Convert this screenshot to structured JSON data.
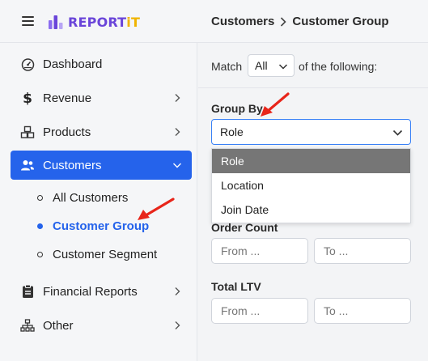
{
  "header": {
    "logo_part1": "REPORT",
    "logo_part2": "iT",
    "breadcrumb": [
      "Customers",
      "Customer Group"
    ]
  },
  "sidebar": {
    "items": [
      {
        "label": "Dashboard",
        "icon": "gauge-icon"
      },
      {
        "label": "Revenue",
        "icon": "dollar-icon"
      },
      {
        "label": "Products",
        "icon": "boxes-icon"
      },
      {
        "label": "Customers",
        "icon": "users-icon"
      },
      {
        "label": "Financial Reports",
        "icon": "clipboard-icon"
      },
      {
        "label": "Other",
        "icon": "sitemap-icon"
      }
    ],
    "sub_items": [
      {
        "label": "All Customers"
      },
      {
        "label": "Customer Group"
      },
      {
        "label": "Customer Segment"
      }
    ]
  },
  "main": {
    "match_prefix": "Match",
    "match_value": "All",
    "match_suffix": "of the following:",
    "group_by_label": "Group By",
    "group_by_value": "Role",
    "group_by_options": [
      "Role",
      "Location",
      "Join Date"
    ],
    "order_count_label": "Order Count",
    "total_ltv_label": "Total LTV",
    "from_placeholder": "From ...",
    "to_placeholder": "To ..."
  },
  "colors": {
    "accent": "#2563eb",
    "logo_purple": "#6a45d9",
    "logo_yellow": "#f0b400",
    "annotation_arrow": "#e8251a"
  }
}
